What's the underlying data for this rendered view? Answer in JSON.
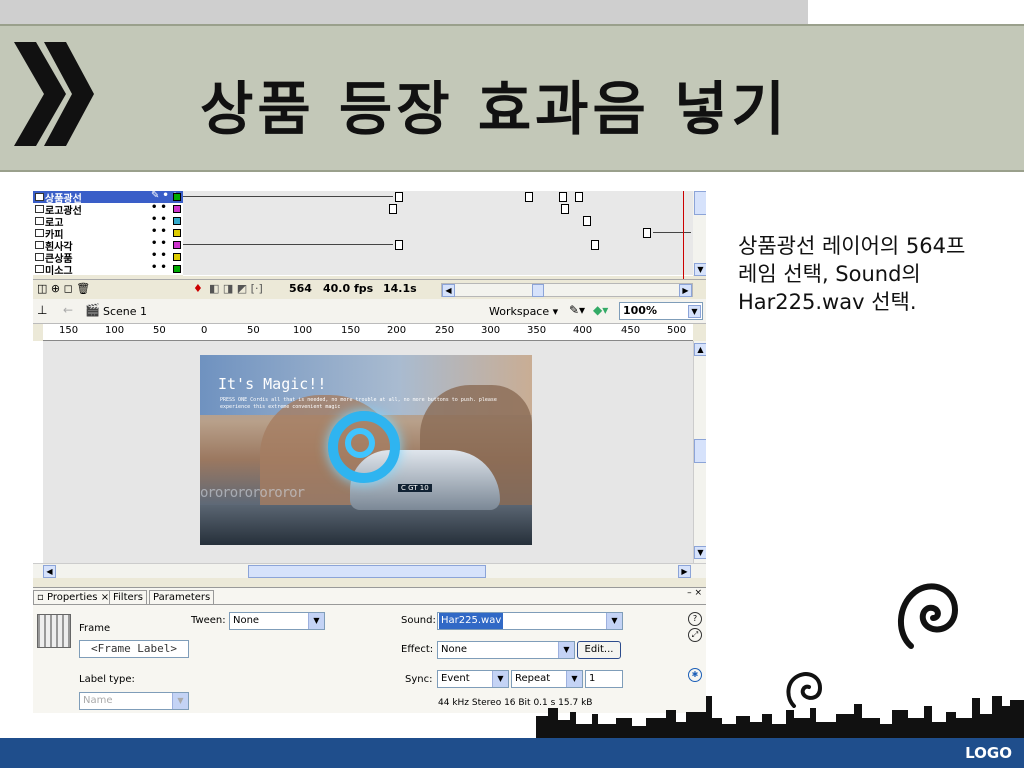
{
  "slide": {
    "title": "상품 등장 효과음 넣기",
    "description": "상품광선 레이어의 564프레임 선택, Sound의 Har225.wav 선택.",
    "logo": "LOGO"
  },
  "timeline": {
    "layers": [
      {
        "name": "상품광선",
        "color": "#00aa00",
        "selected": true
      },
      {
        "name": "로고광선",
        "color": "#cc33cc"
      },
      {
        "name": "로고",
        "color": "#33aacc"
      },
      {
        "name": "카피",
        "color": "#ddcc00"
      },
      {
        "name": "흰사각",
        "color": "#cc33cc"
      },
      {
        "name": "큰상품",
        "color": "#ddcc00"
      },
      {
        "name": "미소그",
        "color": "#00aa00"
      }
    ],
    "current_frame": "564",
    "fps": "40.0 fps",
    "time": "14.1s"
  },
  "scene_bar": {
    "scene": "Scene 1",
    "workspace": "Workspace",
    "zoom": "100%"
  },
  "ruler_ticks": [
    "150",
    "100",
    "50",
    "0",
    "50",
    "100",
    "150",
    "200",
    "250",
    "300",
    "350",
    "400",
    "450",
    "500"
  ],
  "stage_art": {
    "headline": "It's Magic!!",
    "subline": "PRESS ONE Cordis all that is needed, no more trouble at all, no more buttons to push. please experience this extreme convenient magic",
    "plate": "C GT 10",
    "filmstrip": "ororororororor"
  },
  "properties": {
    "tabs": [
      "Properties",
      "Filters",
      "Parameters"
    ],
    "frame_label": "Frame",
    "frame_label_placeholder": "<Frame Label>",
    "label_type_label": "Label type:",
    "label_type_value": "Name",
    "tween_label": "Tween:",
    "tween_value": "None",
    "sound_label": "Sound:",
    "sound_value": "Har225.wav",
    "effect_label": "Effect:",
    "effect_value": "None",
    "edit_button": "Edit...",
    "sync_label": "Sync:",
    "sync_value": "Event",
    "repeat_value": "Repeat",
    "repeat_count": "1",
    "sound_info": "44 kHz Stereo 16 Bit 0.1 s 15.7 kB"
  }
}
